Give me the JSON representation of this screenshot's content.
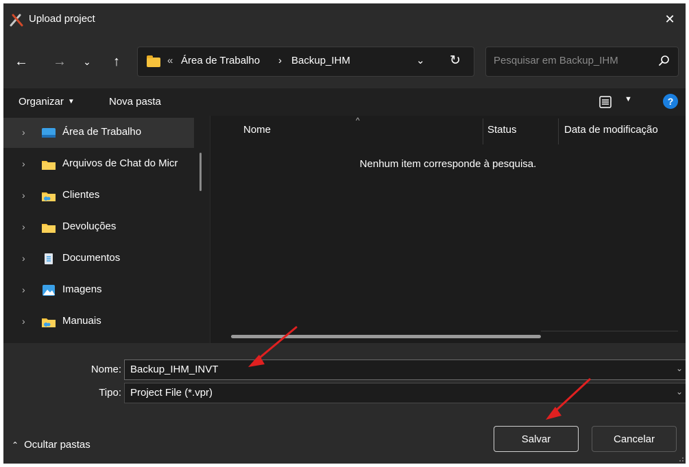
{
  "window": {
    "title": "Upload project"
  },
  "nav": {
    "breadcrumb": [
      "Área de Trabalho",
      "Backup_IHM"
    ],
    "overflow_glyph": "«",
    "separator": "›",
    "search_placeholder": "Pesquisar em Backup_IHM"
  },
  "toolbar": {
    "organize_label": "Organizar",
    "new_folder_label": "Nova pasta"
  },
  "sidebar": {
    "items": [
      {
        "label": "Área de Trabalho",
        "icon": "desktop-icon",
        "selected": true
      },
      {
        "label": "Arquivos de Chat do Micr",
        "icon": "folder-icon",
        "selected": false
      },
      {
        "label": "Clientes",
        "icon": "shared-folder-icon",
        "selected": false
      },
      {
        "label": "Devoluções",
        "icon": "folder-icon",
        "selected": false
      },
      {
        "label": "Documentos",
        "icon": "document-icon",
        "selected": false
      },
      {
        "label": "Imagens",
        "icon": "pictures-icon",
        "selected": false
      },
      {
        "label": "Manuais",
        "icon": "shared-folder-icon",
        "selected": false
      }
    ]
  },
  "file_list": {
    "columns": [
      "Nome",
      "Status",
      "Data de modificação"
    ],
    "empty_message": "Nenhum item corresponde à pesquisa."
  },
  "form": {
    "name_label": "Nome:",
    "name_value": "Backup_IHM_INVT",
    "type_label": "Tipo:",
    "type_value": "Project File (*.vpr)"
  },
  "footer": {
    "hide_folders_label": "Ocultar pastas",
    "save_label": "Salvar",
    "cancel_label": "Cancelar"
  },
  "colors": {
    "background": "#202020",
    "chrome": "#2b2b2b",
    "folder": "#f7c23c",
    "accent": "#1a7fe0",
    "annotation": "#e02020"
  }
}
